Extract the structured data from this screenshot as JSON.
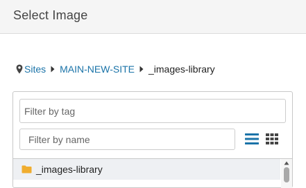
{
  "dialog": {
    "title": "Select Image"
  },
  "breadcrumb": {
    "icon": "map-marker-icon",
    "items": [
      {
        "label": "Sites",
        "link": true
      },
      {
        "label": "MAIN-NEW-SITE",
        "link": true
      },
      {
        "label": "_images-library",
        "link": false
      }
    ],
    "separator_icon": "caret-right-icon"
  },
  "filters": {
    "tag_placeholder": "Filter by tag",
    "tag_value": "",
    "name_placeholder": "Filter by name",
    "name_value": ""
  },
  "view_toggle": {
    "list_icon": "list-view-icon",
    "grid_icon": "grid-view-icon",
    "active": "list"
  },
  "file_list": {
    "items": [
      {
        "type": "folder",
        "icon": "folder-icon",
        "label": "_images-library"
      }
    ]
  },
  "colors": {
    "link": "#1a73a8",
    "active_icon": "#1a73a8",
    "inactive_icon": "#444444",
    "folder": "#f0ad2f",
    "row_selected_bg": "#eef0f3",
    "header_bg": "#f5f5f5"
  }
}
